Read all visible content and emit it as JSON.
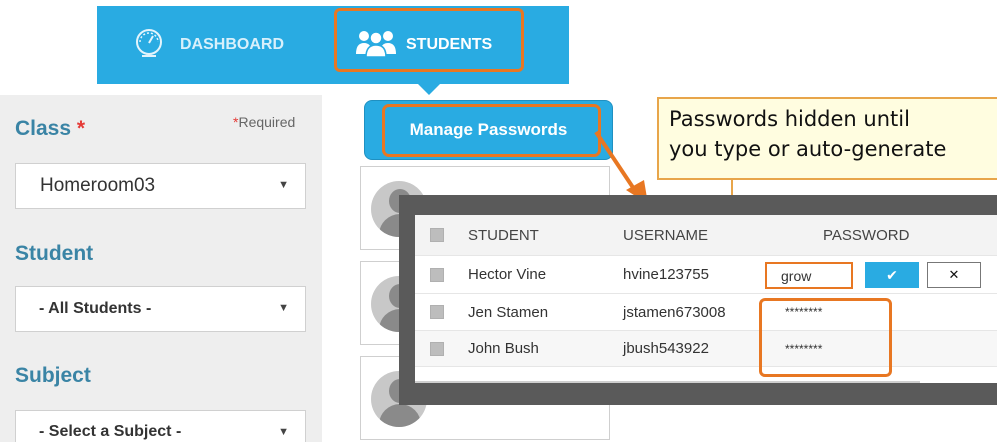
{
  "nav": {
    "items": [
      {
        "label": "DASHBOARD",
        "icon": "speedometer-icon"
      },
      {
        "label": "STUDENTS",
        "icon": "users-group-icon"
      }
    ],
    "active": "STUDENTS",
    "accent": "#29abe2",
    "highlight": "#e87722"
  },
  "filters": {
    "class_label": "Class",
    "class_asterisk": "*",
    "required_mark": "*",
    "required_text": "Required",
    "class_value": "Homeroom03",
    "student_label": "Student",
    "student_value": "- All Students -",
    "subject_label": "Subject",
    "subject_value": "- Select a Subject -"
  },
  "manage": {
    "label": "Manage Passwords"
  },
  "callout": {
    "line1": "Passwords hidden until",
    "line2": "you type or auto-generate"
  },
  "table": {
    "headers": {
      "student": "STUDENT",
      "username": "USERNAME",
      "password": "PASSWORD"
    },
    "rows": [
      {
        "student": "Hector Vine",
        "username": "hvine123755",
        "password": "grow",
        "editing": true
      },
      {
        "student": "Jen Stamen",
        "username": "jstamen673008",
        "password": "********",
        "editing": false
      },
      {
        "student": "John Bush",
        "username": "jbush543922",
        "password": "********",
        "editing": false
      }
    ],
    "confirm_icon": "checkmark-icon",
    "cancel_icon": "close-icon",
    "confirm_glyph": "✔",
    "cancel_glyph": "✕"
  }
}
